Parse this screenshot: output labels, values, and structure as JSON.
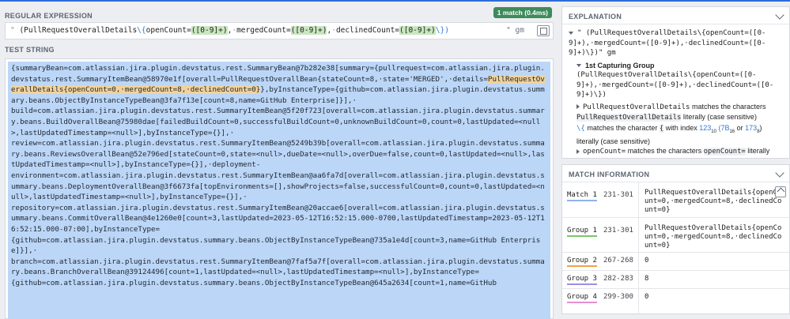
{
  "regex_section": {
    "title": "REGULAR EXPRESSION",
    "match_badge": "1 match (0.4ms)",
    "delimiter_open": "\" ",
    "flags": "\" gm",
    "parts": {
      "p1": "(PullRequestOverallDetails",
      "p2": "\\{",
      "p3": "openCount=",
      "p4": "([0-9]+)",
      "p5": ",",
      "p6": "·",
      "p7": "mergedCount=",
      "p8": "([0-9]+)",
      "p9": ",",
      "p10": "·",
      "p11": "declinedCount=",
      "p12": "([0-9]+)",
      "p13": "\\})"
    }
  },
  "test_string_section": {
    "title": "TEST STRING",
    "before": "{summaryBean=com.atlassian.jira.plugin.devstatus.rest.SummaryBean@7b282e38[summary={pullrequest=com.atlassian.jira.plugin.devstatus.rest.SummaryItemBean@58970e1f[overall=PullRequestOverallBean{stateCount=8,·state='MERGED',·details=",
    "match": "PullRequestOverallDetails{openCount=0,·mergedCount=8,·declinedCount=0}",
    "after": "},byInstanceType={github=com.atlassian.jira.plugin.devstatus.summary.beans.ObjectByInstanceTypeBean@3fa7f13e[count=8,name=GitHub Enterprise]}],·\nbuild=com.atlassian.jira.plugin.devstatus.rest.SummaryItemBean@5f20f723[overall=com.atlassian.jira.plugin.devstatus.summary.beans.BuildOverallBean@75980dae[failedBuildCount=0,successfulBuildCount=0,unknownBuildCount=0,count=0,lastUpdated=<null>,lastUpdatedTimestamp=<null>],byInstanceType={}],·\nreview=com.atlassian.jira.plugin.devstatus.rest.SummaryItemBean@5249b39b[overall=com.atlassian.jira.plugin.devstatus.summary.beans.ReviewsOverallBean@52e796ed[stateCount=0,state=<null>,dueDate=<null>,overDue=false,count=0,lastUpdated=<null>,lastUpdatedTimestamp=<null>],byInstanceType={}],·deployment-\nenvironment=com.atlassian.jira.plugin.devstatus.rest.SummaryItemBean@aa6fa7d[overall=com.atlassian.jira.plugin.devstatus.summary.beans.DeploymentOverallBean@3f6673fa[topEnvironments=[],showProjects=false,successfulCount=0,count=0,lastUpdated=<null>,lastUpdatedTimestamp=<null>],byInstanceType={}],·\nrepository=com.atlassian.jira.plugin.devstatus.rest.SummaryItemBean@20accae6[overall=com.atlassian.jira.plugin.devstatus.summary.beans.CommitOverallBean@4e1260e0[count=3,lastUpdated=2023-05-12T16:52:15.000-0700,lastUpdatedTimestamp=2023-05-12T16:52:15.000-07:00],byInstanceType=\n{github=com.atlassian.jira.plugin.devstatus.summary.beans.ObjectByInstanceTypeBean@735a1e4d[count=3,name=GitHub Enterprise]}],·\nbranch=com.atlassian.jira.plugin.devstatus.rest.SummaryItemBean@7faf5a7f[overall=com.atlassian.jira.plugin.devstatus.summary.beans.BranchOverallBean@39124496[count=1,lastUpdated=<null>,lastUpdatedTimestamp=<null>],byInstanceType=\n{github=com.atlassian.jira.plugin.devstatus.summary.beans.ObjectByInstanceTypeBean@645a2634[count=1,name=GitHub"
  },
  "explanation": {
    "title": "EXPLANATION",
    "line1_pre": "\" ",
    "line1_regex": "(PullRequestOverallDetails\\{openCount=([0-9]+),·mergedCount=([0-9]+),·declinedCount=([0-9]+)\\})",
    "line1_flags": "\" gm",
    "group_title": "1st Capturing Group",
    "group_regex": "(PullRequestOverallDetails\\{openCount=([0-9]+),·mergedCount=([0-9]+),·declinedCount=([0-9]+)\\})",
    "item1_token": "PullRequestOverallDetails",
    "item1_text": " matches the characters ",
    "item1_token2": "PullRequestOverallDetails",
    "item1_text2": " literally (case sensitive)",
    "item2_token": "\\{",
    "item2_text_a": " matches the character ",
    "item2_char": "{",
    "item2_text_b": " with index ",
    "item2_idx": "123",
    "item2_sub10": "10",
    "item2_hex": "(7B",
    "item2_sub16": "16",
    "item2_or": " or ",
    "item2_oct": "173",
    "item2_sub8": "8",
    "item2_close": ")",
    "item2_text_c": "literally (case sensitive)",
    "item3_token": "openCount=",
    "item3_text": " matches the characters ",
    "item3_token2": "openCount=",
    "item3_text2": " literally"
  },
  "match_info": {
    "title": "MATCH INFORMATION",
    "rows": [
      {
        "label": "Match 1",
        "range": "231-301",
        "value": "PullRequestOverallDetails{openCount=0,·mergedCount=8,·declinedCount=0}",
        "color": "#8fb4ea"
      },
      {
        "label": "Group 1",
        "range": "231-301",
        "value": "PullRequestOverallDetails{openCount=0,·mergedCount=8,·declinedCount=0}",
        "color": "#7cc46b"
      },
      {
        "label": "Group 2",
        "range": "267-268",
        "value": "0",
        "color": "#f0a34a"
      },
      {
        "label": "Group 3",
        "range": "282-283",
        "value": "8",
        "color": "#9c8fe0"
      },
      {
        "label": "Group 4",
        "range": "299-300",
        "value": "0",
        "color": "#e78fd0"
      }
    ]
  }
}
